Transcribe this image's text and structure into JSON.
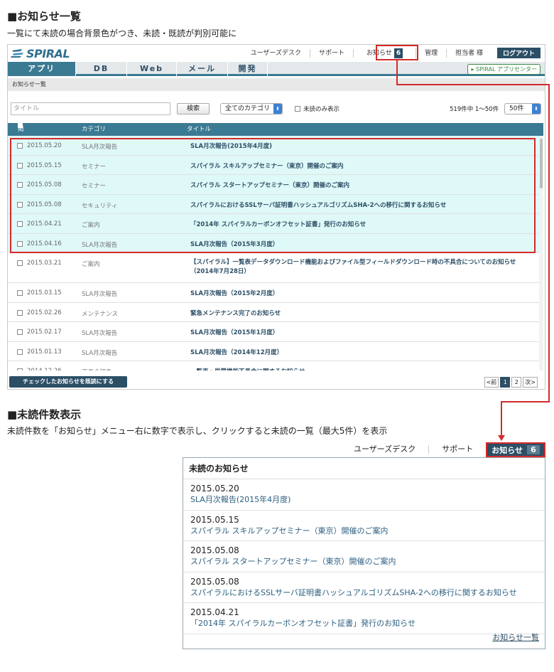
{
  "section1": {
    "title": "■お知らせ一覧",
    "desc": "一覧にて未読の場合背景色がつき、未読・既読が判別可能に"
  },
  "section2": {
    "title": "■未読件数表示",
    "desc": "未読件数を「お知らせ」メニュー右に数字で表示し、クリックすると未読の一覧（最大5件）を表示"
  },
  "app": {
    "logo": "SPIRAL",
    "toplinks": {
      "userdesk": "ユーザーズデスク",
      "support": "サポート",
      "notice": "お知らせ",
      "notice_count": "6",
      "admin": "管理",
      "user": "担当者 様",
      "logout": "ログアウト"
    },
    "tabs": [
      "アプリ",
      "DB",
      "Web",
      "メール",
      "開発"
    ],
    "spiral_app_center": "▸ SPIRAL アプリセンター",
    "breadcrumb": "お知らせ一覧",
    "filter": {
      "title_placeholder": "タイトル",
      "search": "検索",
      "category": "全てのカテゴリ",
      "unread_only": "未読のみ表示",
      "count": "519件中 1〜50件",
      "per_page": "50件"
    },
    "columns": [
      "掲載日時",
      "カテゴリ",
      "タイトル"
    ],
    "rows": [
      {
        "date": "2015.05.20",
        "category": "SLA月次報告",
        "title": "SLA月次報告(2015年4月度)",
        "unread": true
      },
      {
        "date": "2015.05.15",
        "category": "セミナー",
        "title": "スパイラル スキルアップセミナー（東京）開催のご案内",
        "unread": true
      },
      {
        "date": "2015.05.08",
        "category": "セミナー",
        "title": "スパイラル スタートアップセミナー（東京）開催のご案内",
        "unread": true
      },
      {
        "date": "2015.05.08",
        "category": "セキュリティ",
        "title": "スパイラルにおけるSSLサーバ証明書ハッシュアルゴリズムSHA-2への移行に関するお知らせ",
        "unread": true
      },
      {
        "date": "2015.04.21",
        "category": "ご案内",
        "title": "「2014年 スパイラルカーボンオフセット証書」発行のお知らせ",
        "unread": true
      },
      {
        "date": "2015.04.16",
        "category": "SLA月次報告",
        "title": "SLA月次報告（2015年3月度）",
        "unread": true
      },
      {
        "date": "2015.03.21",
        "category": "ご案内",
        "title": "【スパイラル】一覧表データダウンロード機能およびファイル型フィールドダウンロード時の不具合についてのお知らせ（2014年7月28日）",
        "unread": false,
        "tall": true
      },
      {
        "date": "2015.03.15",
        "category": "SLA月次報告",
        "title": "SLA月次報告（2015年2月度）",
        "unread": false
      },
      {
        "date": "2015.02.26",
        "category": "メンテナンス",
        "title": "緊急メンテナンス完了のお知らせ",
        "unread": false
      },
      {
        "date": "2015.02.17",
        "category": "SLA月次報告",
        "title": "SLA月次報告（2015年1月度）",
        "unread": false
      },
      {
        "date": "2015.01.13",
        "category": "SLA月次報告",
        "title": "SLA月次報告（2014年12月度）",
        "unread": false
      },
      {
        "date": "2014.12.26",
        "category": "不具合報告",
        "title": "一覧表・単票機能不具合に関するお知らせ",
        "unread": false
      }
    ],
    "mark_read_button": "チェックしたお知らせを既読にする",
    "pager": [
      "<前",
      "1",
      "2",
      "次>"
    ]
  },
  "dropdown": {
    "nav": {
      "userdesk": "ユーザーズデスク",
      "support": "サポート",
      "notice": "お知らせ",
      "notice_count": "6"
    },
    "header": "未読のお知らせ",
    "items": [
      {
        "date": "2015.05.20",
        "title": "SLA月次報告(2015年4月度)"
      },
      {
        "date": "2015.05.15",
        "title": "スパイラル スキルアップセミナー（東京）開催のご案内"
      },
      {
        "date": "2015.05.08",
        "title": "スパイラル スタートアップセミナー（東京）開催のご案内"
      },
      {
        "date": "2015.05.08",
        "title": "スパイラルにおけるSSLサーバ証明書ハッシュアルゴリズムSHA-2への移行に関するお知らせ"
      },
      {
        "date": "2015.04.21",
        "title": "「2014年 スパイラルカーボンオフセット証書」発行のお知らせ"
      }
    ],
    "footer_link": "お知らせ一覧"
  },
  "colors": {
    "accent": "#3b7a93",
    "navy": "#2c4f66",
    "highlight": "#d42a2a",
    "unread_bg": "#dff8f8"
  }
}
